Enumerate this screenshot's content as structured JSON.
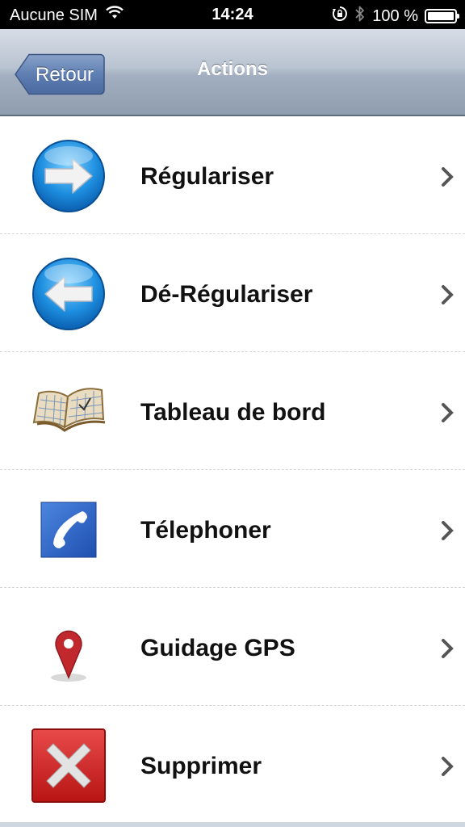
{
  "status_bar": {
    "carrier": "Aucune SIM",
    "time": "14:24",
    "battery": "100 %",
    "icons": [
      "wifi-icon",
      "orientation-lock-icon",
      "bluetooth-icon",
      "battery-icon"
    ]
  },
  "nav": {
    "back_label": "Retour",
    "title": "Actions"
  },
  "items": [
    {
      "label": "Régulariser",
      "icon": "arrow-right-icon"
    },
    {
      "label": "Dé-Régulariser",
      "icon": "arrow-left-icon"
    },
    {
      "label": "Tableau de bord",
      "icon": "map-book-icon"
    },
    {
      "label": "Télephoner",
      "icon": "phone-icon"
    },
    {
      "label": "Guidage GPS",
      "icon": "map-pin-icon"
    },
    {
      "label": "Supprimer",
      "icon": "delete-x-icon"
    }
  ],
  "colors": {
    "nav_gradient_top": "#d7dde6",
    "nav_gradient_bottom": "#8f9db0",
    "back_button": "#5a7bb0",
    "phone_blue": "#2f68cc",
    "pin_red": "#c0282e",
    "delete_red": "#cc1f1f"
  }
}
